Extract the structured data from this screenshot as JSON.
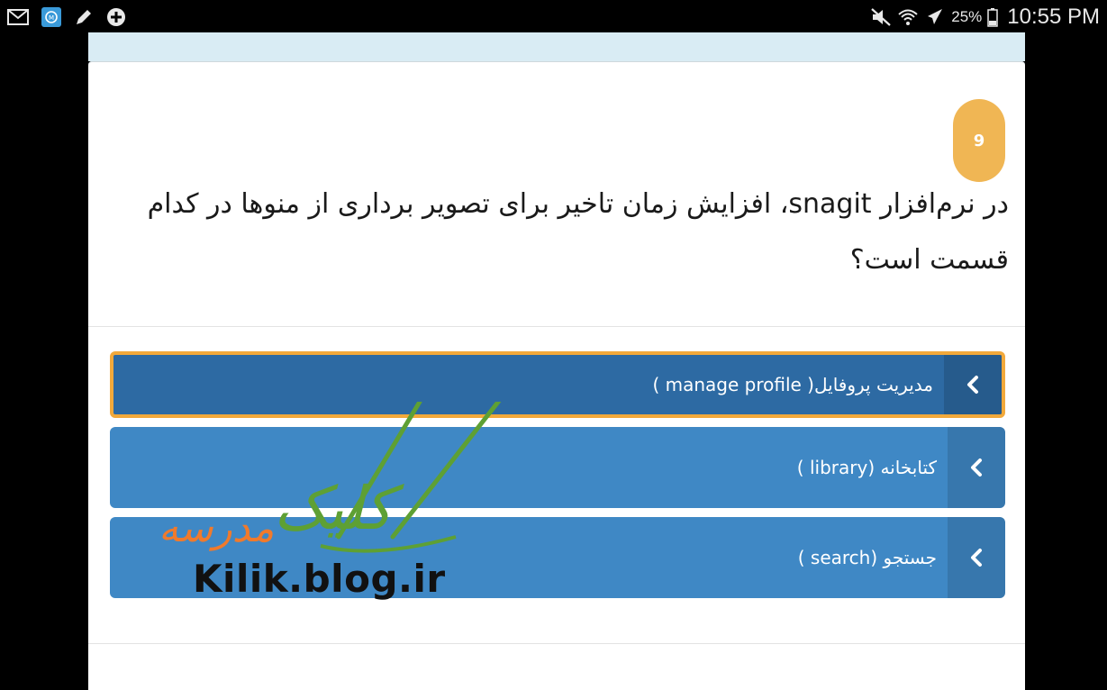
{
  "status_bar": {
    "battery": "25%",
    "clock": "10:55 PM",
    "left_icons": [
      "mail-icon",
      "maxthon-app-icon",
      "pencil-icon",
      "add-circle-icon"
    ],
    "right_icons": [
      "mute-icon",
      "wifi-icon",
      "airplane-icon",
      "battery-icon"
    ]
  },
  "question": {
    "number": "9",
    "text": "در نرم‌افزار snagit، افزایش زمان تاخیر برای تصویر برداری از منوها در کدام قسمت است؟"
  },
  "options": [
    {
      "label": "مدیریت پروفایل( manage profile )",
      "selected": true
    },
    {
      "label": "کتابخانه (library )",
      "selected": false
    },
    {
      "label": "جستجو (search )",
      "selected": false
    }
  ],
  "watermark": {
    "site_fa_1": "مدرسه",
    "site_fa_2": "کلیک",
    "url": "Kilik.blog.ir"
  },
  "colors": {
    "option_bg": "#3f88c5",
    "option_selected_bg": "#2d6aa3",
    "selected_border": "#f2a93b",
    "badge": "#f0b654"
  }
}
